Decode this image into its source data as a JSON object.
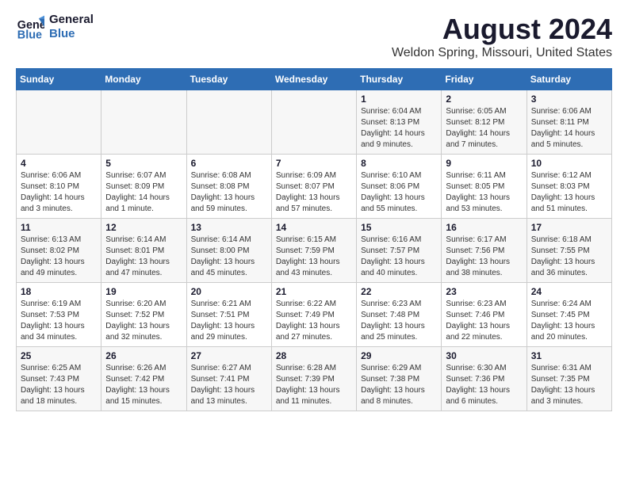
{
  "logo": {
    "line1": "General",
    "line2": "Blue"
  },
  "title": "August 2024",
  "subtitle": "Weldon Spring, Missouri, United States",
  "headers": [
    "Sunday",
    "Monday",
    "Tuesday",
    "Wednesday",
    "Thursday",
    "Friday",
    "Saturday"
  ],
  "weeks": [
    [
      {
        "day": "",
        "info": ""
      },
      {
        "day": "",
        "info": ""
      },
      {
        "day": "",
        "info": ""
      },
      {
        "day": "",
        "info": ""
      },
      {
        "day": "1",
        "info": "Sunrise: 6:04 AM\nSunset: 8:13 PM\nDaylight: 14 hours\nand 9 minutes."
      },
      {
        "day": "2",
        "info": "Sunrise: 6:05 AM\nSunset: 8:12 PM\nDaylight: 14 hours\nand 7 minutes."
      },
      {
        "day": "3",
        "info": "Sunrise: 6:06 AM\nSunset: 8:11 PM\nDaylight: 14 hours\nand 5 minutes."
      }
    ],
    [
      {
        "day": "4",
        "info": "Sunrise: 6:06 AM\nSunset: 8:10 PM\nDaylight: 14 hours\nand 3 minutes."
      },
      {
        "day": "5",
        "info": "Sunrise: 6:07 AM\nSunset: 8:09 PM\nDaylight: 14 hours\nand 1 minute."
      },
      {
        "day": "6",
        "info": "Sunrise: 6:08 AM\nSunset: 8:08 PM\nDaylight: 13 hours\nand 59 minutes."
      },
      {
        "day": "7",
        "info": "Sunrise: 6:09 AM\nSunset: 8:07 PM\nDaylight: 13 hours\nand 57 minutes."
      },
      {
        "day": "8",
        "info": "Sunrise: 6:10 AM\nSunset: 8:06 PM\nDaylight: 13 hours\nand 55 minutes."
      },
      {
        "day": "9",
        "info": "Sunrise: 6:11 AM\nSunset: 8:05 PM\nDaylight: 13 hours\nand 53 minutes."
      },
      {
        "day": "10",
        "info": "Sunrise: 6:12 AM\nSunset: 8:03 PM\nDaylight: 13 hours\nand 51 minutes."
      }
    ],
    [
      {
        "day": "11",
        "info": "Sunrise: 6:13 AM\nSunset: 8:02 PM\nDaylight: 13 hours\nand 49 minutes."
      },
      {
        "day": "12",
        "info": "Sunrise: 6:14 AM\nSunset: 8:01 PM\nDaylight: 13 hours\nand 47 minutes."
      },
      {
        "day": "13",
        "info": "Sunrise: 6:14 AM\nSunset: 8:00 PM\nDaylight: 13 hours\nand 45 minutes."
      },
      {
        "day": "14",
        "info": "Sunrise: 6:15 AM\nSunset: 7:59 PM\nDaylight: 13 hours\nand 43 minutes."
      },
      {
        "day": "15",
        "info": "Sunrise: 6:16 AM\nSunset: 7:57 PM\nDaylight: 13 hours\nand 40 minutes."
      },
      {
        "day": "16",
        "info": "Sunrise: 6:17 AM\nSunset: 7:56 PM\nDaylight: 13 hours\nand 38 minutes."
      },
      {
        "day": "17",
        "info": "Sunrise: 6:18 AM\nSunset: 7:55 PM\nDaylight: 13 hours\nand 36 minutes."
      }
    ],
    [
      {
        "day": "18",
        "info": "Sunrise: 6:19 AM\nSunset: 7:53 PM\nDaylight: 13 hours\nand 34 minutes."
      },
      {
        "day": "19",
        "info": "Sunrise: 6:20 AM\nSunset: 7:52 PM\nDaylight: 13 hours\nand 32 minutes."
      },
      {
        "day": "20",
        "info": "Sunrise: 6:21 AM\nSunset: 7:51 PM\nDaylight: 13 hours\nand 29 minutes."
      },
      {
        "day": "21",
        "info": "Sunrise: 6:22 AM\nSunset: 7:49 PM\nDaylight: 13 hours\nand 27 minutes."
      },
      {
        "day": "22",
        "info": "Sunrise: 6:23 AM\nSunset: 7:48 PM\nDaylight: 13 hours\nand 25 minutes."
      },
      {
        "day": "23",
        "info": "Sunrise: 6:23 AM\nSunset: 7:46 PM\nDaylight: 13 hours\nand 22 minutes."
      },
      {
        "day": "24",
        "info": "Sunrise: 6:24 AM\nSunset: 7:45 PM\nDaylight: 13 hours\nand 20 minutes."
      }
    ],
    [
      {
        "day": "25",
        "info": "Sunrise: 6:25 AM\nSunset: 7:43 PM\nDaylight: 13 hours\nand 18 minutes."
      },
      {
        "day": "26",
        "info": "Sunrise: 6:26 AM\nSunset: 7:42 PM\nDaylight: 13 hours\nand 15 minutes."
      },
      {
        "day": "27",
        "info": "Sunrise: 6:27 AM\nSunset: 7:41 PM\nDaylight: 13 hours\nand 13 minutes."
      },
      {
        "day": "28",
        "info": "Sunrise: 6:28 AM\nSunset: 7:39 PM\nDaylight: 13 hours\nand 11 minutes."
      },
      {
        "day": "29",
        "info": "Sunrise: 6:29 AM\nSunset: 7:38 PM\nDaylight: 13 hours\nand 8 minutes."
      },
      {
        "day": "30",
        "info": "Sunrise: 6:30 AM\nSunset: 7:36 PM\nDaylight: 13 hours\nand 6 minutes."
      },
      {
        "day": "31",
        "info": "Sunrise: 6:31 AM\nSunset: 7:35 PM\nDaylight: 13 hours\nand 3 minutes."
      }
    ]
  ]
}
